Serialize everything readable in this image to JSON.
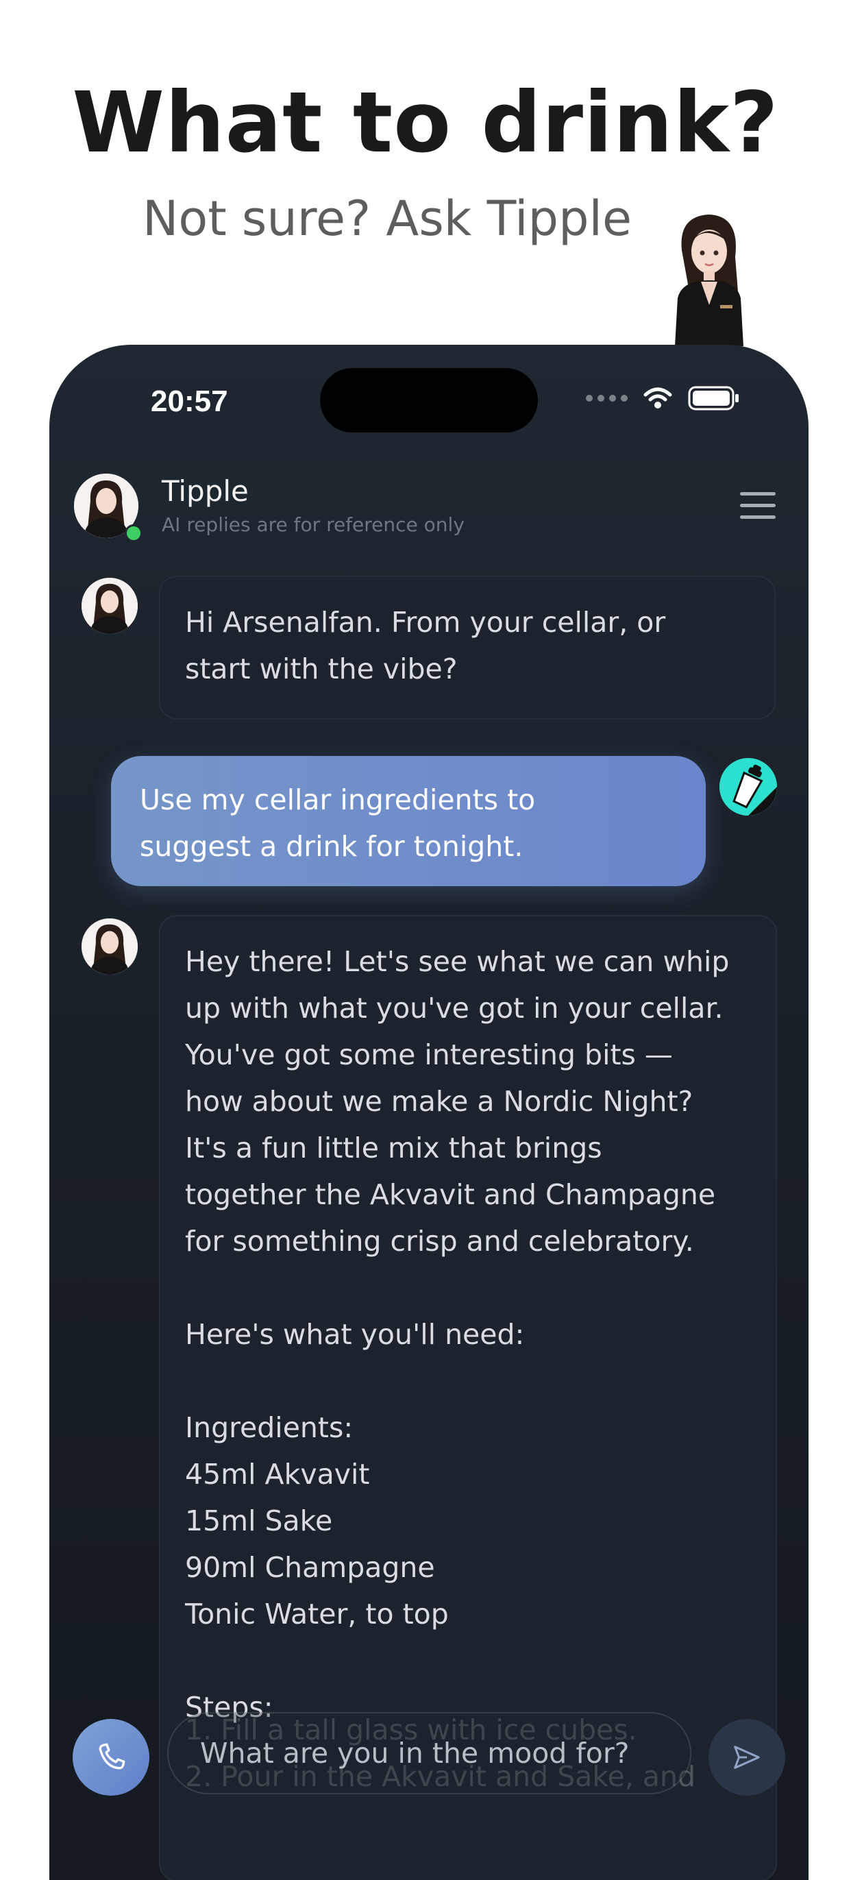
{
  "promo": {
    "headline": "What to drink?",
    "subheadline": "Not sure? Ask Tipple"
  },
  "status_bar": {
    "time": "20:57",
    "icons": [
      "signal-dots-icon",
      "wifi-icon",
      "battery-icon"
    ]
  },
  "chat_header": {
    "name": "Tipple",
    "subtitle": "AI replies are for reference only",
    "status": "online",
    "menu_icon": "hamburger-menu-icon"
  },
  "messages": [
    {
      "sender": "bot",
      "text": "Hi Arsenalfan. From your cellar, or\nstart with the vibe?"
    },
    {
      "sender": "user",
      "text": "Use my cellar ingredients to\nsuggest a drink for tonight."
    },
    {
      "sender": "bot",
      "text": "Hey there! Let's see what we can whip\nup with what you've got in your cellar.\nYou've got some interesting bits —\nhow about we make a Nordic Night?\nIt's a fun little mix that brings\ntogether the Akvavit and Champagne\nfor something crisp and celebratory.\n\nHere's what you'll need:\n\nIngredients:\n45ml Akvavit\n15ml Sake\n90ml Champagne\nTonic Water, to top\n\nSteps:",
      "overflow_lines": [
        "1. Fill a tall glass with ice cubes.",
        "2. Pour in the Akvavit and Sake, and"
      ]
    }
  ],
  "composer": {
    "placeholder": "What are you in the mood for?",
    "call_icon": "phone-icon",
    "send_icon": "send-icon"
  },
  "colors": {
    "accent": "#6a86cc",
    "online": "#3ecf63",
    "user_avatar_bg": "#2ce0cf"
  }
}
